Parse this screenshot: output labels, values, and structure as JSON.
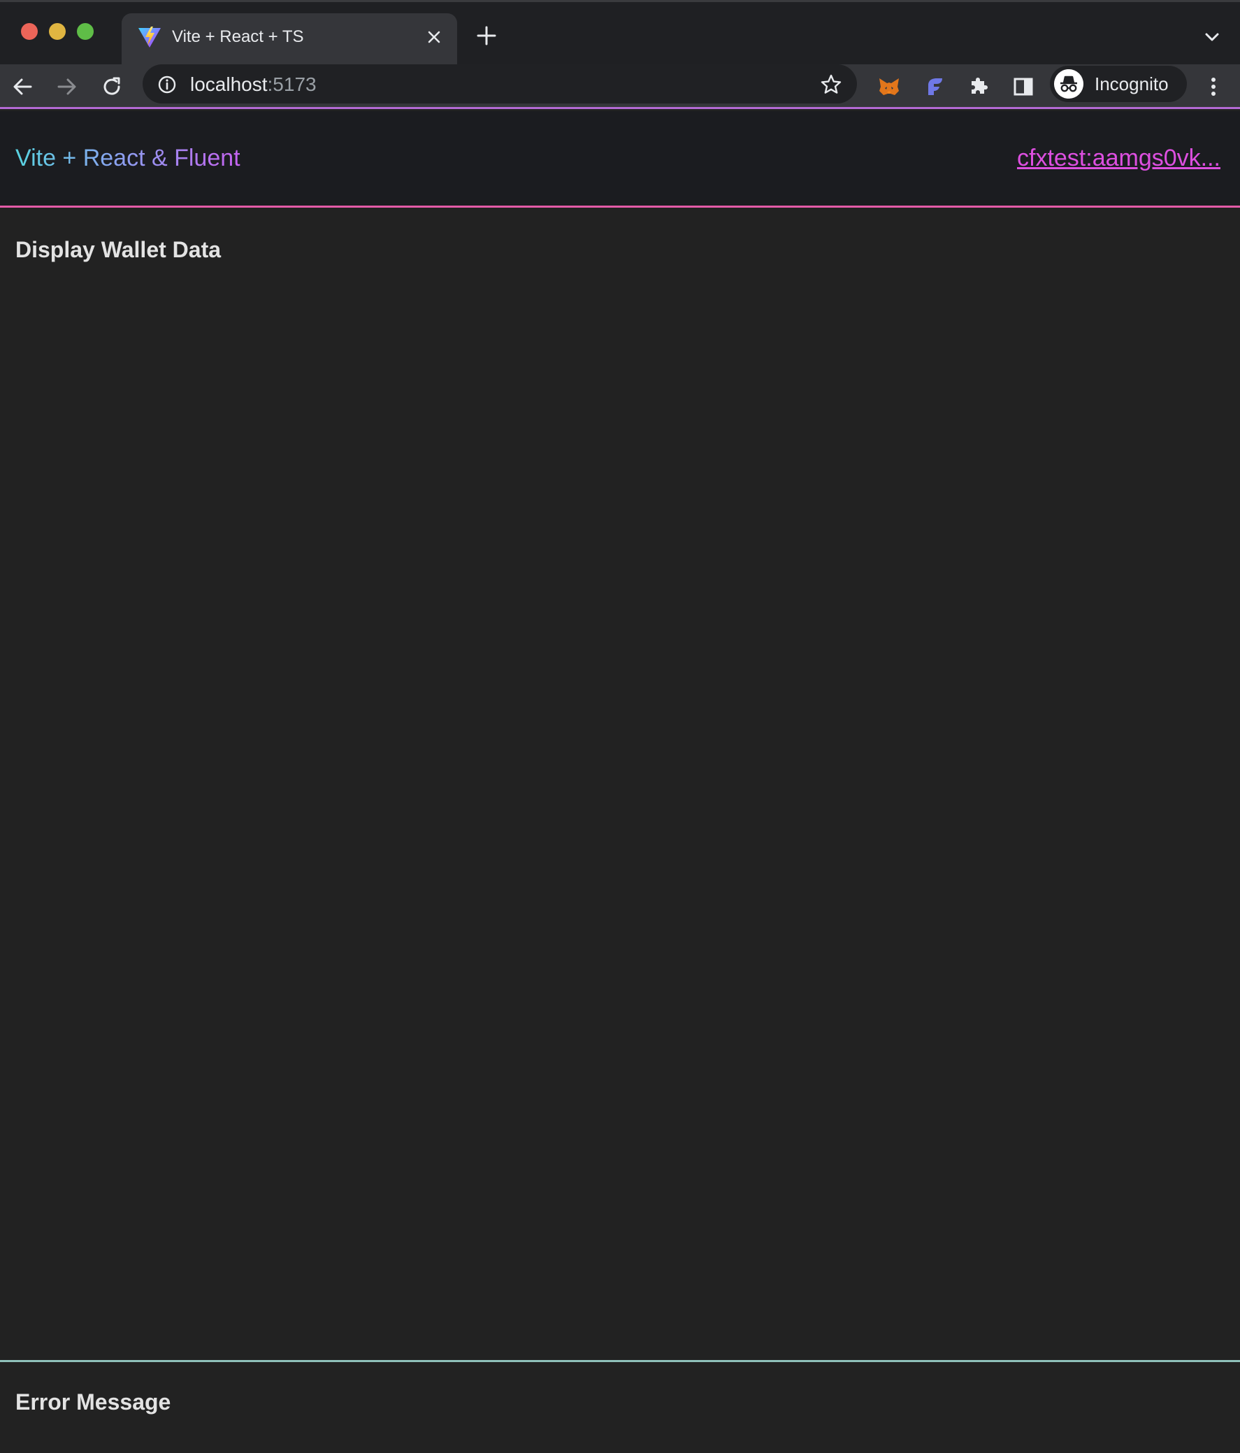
{
  "browser": {
    "tab": {
      "title": "Vite + React + TS",
      "favicon": "vite-logo-icon"
    },
    "address": {
      "host": "localhost",
      "port": ":5173"
    },
    "extensions": [
      "metamask-fox-icon",
      "fluent-wallet-icon",
      "puzzle-extensions-icon",
      "side-panel-icon"
    ],
    "profile": {
      "label": "Incognito",
      "icon": "incognito-icon"
    },
    "colors": {
      "tab_strip": "#1f2023",
      "toolbar": "#35363a",
      "omnibox": "#202124"
    }
  },
  "app": {
    "header": {
      "title": "Vite + React & Fluent",
      "wallet_address": "cfxtest:aamgs0vk..."
    },
    "main": {
      "section_title": "Display Wallet Data"
    },
    "footer": {
      "section_title": "Error Message"
    },
    "colors": {
      "background": "#222222",
      "header_background": "#1b1c20",
      "link": "#dd4fe0",
      "header_border": "#e45ba8",
      "footer_border": "#8fc1ba"
    }
  }
}
